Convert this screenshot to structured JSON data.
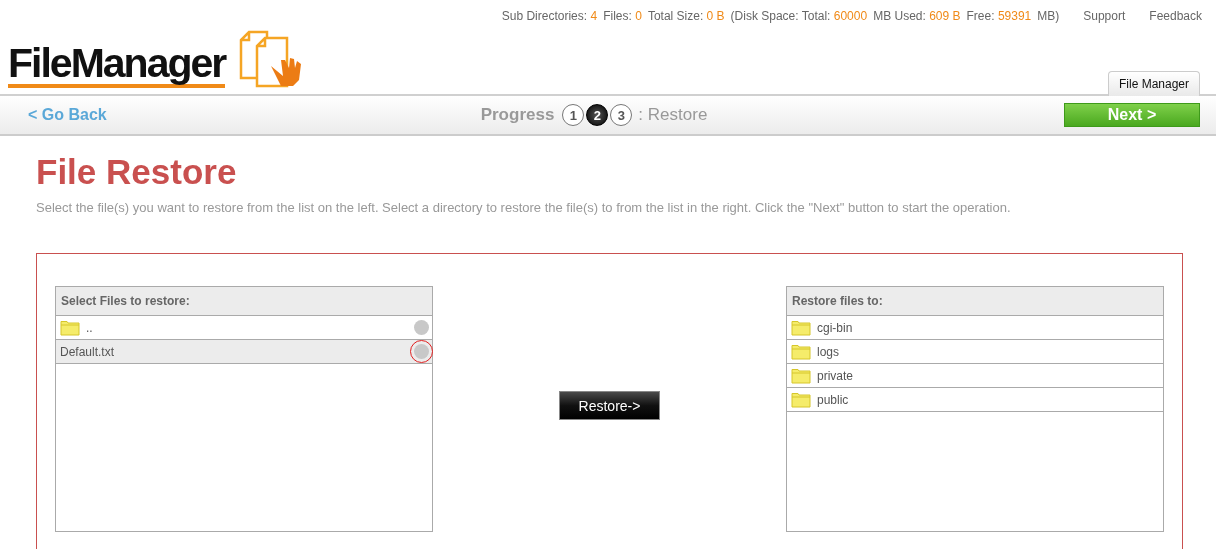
{
  "stats": [
    {
      "label": "Sub Directories:",
      "value": "4"
    },
    {
      "label": "Files:",
      "value": "0"
    },
    {
      "label": "Total Size:",
      "value": "0 B"
    },
    {
      "label": "(Disk Space: Total:",
      "value": "60000"
    },
    {
      "label": "MB Used:",
      "value": "609 B"
    },
    {
      "label": "Free:",
      "value": "59391"
    },
    {
      "label": "MB)"
    }
  ],
  "top_links": [
    "Support",
    "Feedback"
  ],
  "logo": {
    "text": "FileManager"
  },
  "tabs": [
    {
      "label": "File Manager",
      "selected": true
    }
  ],
  "nav": {
    "back": "< Go Back",
    "progress_label": "Progress",
    "steps": [
      {
        "label": "1",
        "selected": false
      },
      {
        "label": "2",
        "selected": true
      },
      {
        "label": "3",
        "selected": false
      }
    ],
    "step_name": ": Restore",
    "next": "Next >"
  },
  "title": "File Restore",
  "description": "Select the file(s) you want to restore from the list on the left. Select a directory to restore the file(s) to from the list in the right. Click the \"Next\" button to start the operation.",
  "source_panel": {
    "header": "Select Files to restore:",
    "items": [
      {
        "kind": "folder",
        "name": "..",
        "selected": false,
        "highlighted": false
      },
      {
        "kind": "file",
        "name": "Default.txt",
        "selected": true,
        "highlighted": true
      }
    ]
  },
  "restore_button": "Restore->",
  "target_panel": {
    "header": "Restore files to:",
    "items": [
      {
        "kind": "folder",
        "name": "cgi-bin"
      },
      {
        "kind": "folder",
        "name": "logs"
      },
      {
        "kind": "folder",
        "name": "private"
      },
      {
        "kind": "folder",
        "name": "public"
      }
    ]
  }
}
